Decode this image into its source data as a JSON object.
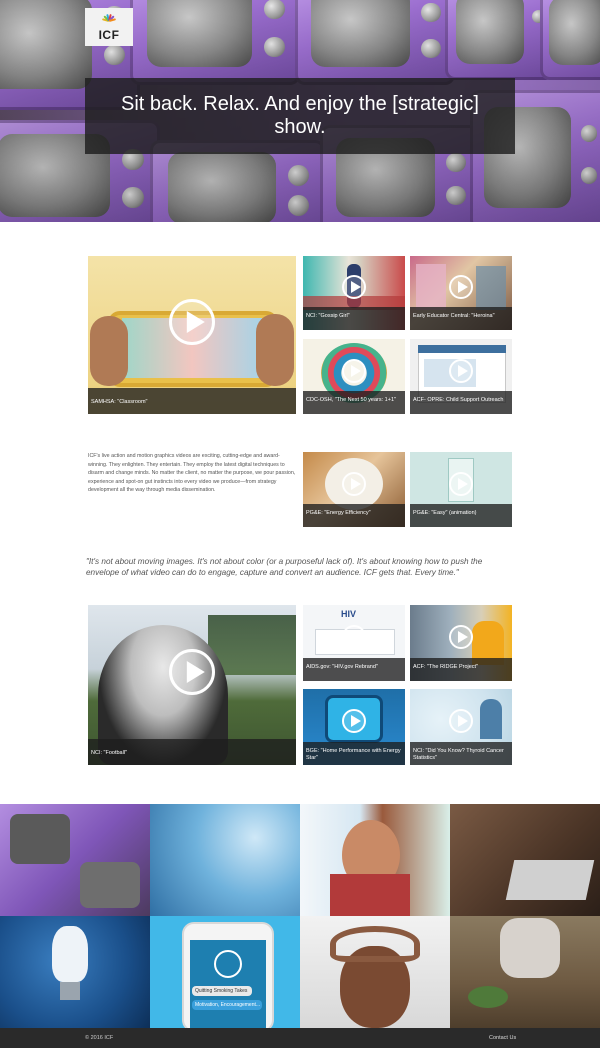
{
  "brand": {
    "logo_text": "ICF",
    "logo_colors": [
      "#e8b51f",
      "#7bc142",
      "#2aa8e0",
      "#e2413b",
      "#8a55c9",
      "#f28c1c"
    ]
  },
  "hero": {
    "headline": "Sit back. Relax. And enjoy the [strategic] show."
  },
  "videos_top": {
    "featured": {
      "caption": "SAMHSA: \"Classroom\""
    },
    "items": [
      {
        "caption": "NCI: \"Gossip Girl\""
      },
      {
        "caption": "Early Educator Central: \"Heroina\""
      },
      {
        "caption": "CDC-OSH, \"The Next 50 years: 1+1\""
      },
      {
        "caption": "ACF- OPRE: Child Support Outreach"
      },
      {
        "caption": "PG&E: \"Energy Efficiency\""
      },
      {
        "caption": "PG&E: \"Easy\" (animation)"
      }
    ]
  },
  "intro_text": "ICF's live action and motion graphics videos are exciting, cutting-edge and award-winning. They enlighten. They entertain. They employ the latest digital techniques to disarm and change minds. No matter the client, no matter the purpose, we pour passion, experience and spot-on gut instincts into every video we produce—from strategy development all the way through media dissemination.",
  "quote": "\"It's not about moving images. It's not about color (or a purposeful lack of). It's about knowing how to push the envelope of what video can do to engage, capture and convert an audience. ICF gets that. Every time.\"",
  "videos_bottom": {
    "featured": {
      "caption": "NCI: \"Football\""
    },
    "items": [
      {
        "caption": "AIDS.gov: \"HIV.gov Rebrand\""
      },
      {
        "caption": "ACF: \"The RIDGE Project\""
      },
      {
        "caption": "BGE: \"Home Performance with Energy Star\""
      },
      {
        "caption": "NCI: \"Did You Know? Thyroid Cancer Statistics\""
      }
    ]
  },
  "mosaic": {
    "hiv_label": "HIV",
    "phone_chip_1": "Quitting Smoking Takes",
    "phone_chip_2": "Motivation, Encouragement..."
  },
  "footer": {
    "copyright": "© 2016   ICF",
    "contact": "Contact Us"
  },
  "colors": {
    "accent_purple": "#9a6fc9",
    "banner_bg": "#1e1e1e",
    "footer_bg": "#2a2a2a"
  }
}
